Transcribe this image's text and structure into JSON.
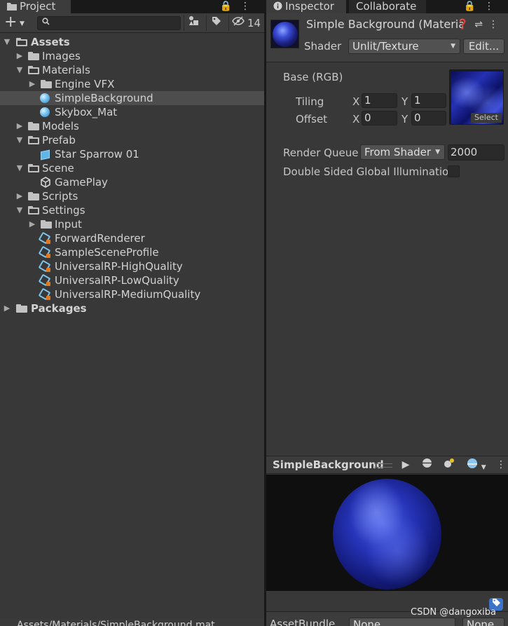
{
  "project": {
    "tab_label": "Project",
    "tab_icons": "🔒 ⋮",
    "toolbar": {
      "plus": "+",
      "search_value": "",
      "search_placeholder": "",
      "hidden_count": "14"
    },
    "tree": [
      {
        "label": "Assets",
        "bold": true
      },
      {
        "label": "Images"
      },
      {
        "label": "Materials"
      },
      {
        "label": "Engine VFX"
      },
      {
        "label": "SimpleBackground"
      },
      {
        "label": "Skybox_Mat"
      },
      {
        "label": "Models"
      },
      {
        "label": "Prefab"
      },
      {
        "label": "Star Sparrow 01"
      },
      {
        "label": "Scene"
      },
      {
        "label": "GamePlay"
      },
      {
        "label": "Scripts"
      },
      {
        "label": "Settings"
      },
      {
        "label": "Input"
      },
      {
        "label": "ForwardRenderer"
      },
      {
        "label": "SampleSceneProfile"
      },
      {
        "label": "UniversalRP-HighQuality"
      },
      {
        "label": "UniversalRP-LowQuality"
      },
      {
        "label": "UniversalRP-MediumQuality"
      },
      {
        "label": "Packages",
        "bold": true
      }
    ],
    "status_path": "Assets/Materials/SimpleBackground.mat"
  },
  "inspector": {
    "tabs": [
      "Inspector",
      "Collaborate"
    ],
    "tab_icons": "🔒 ⋮",
    "material_title": "Simple Background (Material)",
    "shader_label": "Shader",
    "shader_value": "Unlit/Texture",
    "edit_button": "Edit...",
    "base_label": "Base (RGB)",
    "tiling_label": "Tiling",
    "offset_label": "Offset",
    "x_axis": "X",
    "y_axis": "Y",
    "tiling_x": "1",
    "tiling_y": "1",
    "offset_x": "0",
    "offset_y": "0",
    "select_label": "Select",
    "render_queue_label": "Render Queue",
    "render_queue_mode": "From Shader",
    "render_queue_value": "2000",
    "dsgi_label": "Double Sided Global Illumination",
    "preview_title": "SimpleBackground",
    "assetbundle_label": "AssetBundle",
    "assetbundle_value": "None",
    "variant_value": "None"
  },
  "watermark": "CSDN @dangoxiba",
  "colors": {
    "panel_bg": "#383838",
    "tab_bar_bg": "#191919",
    "selected_row": "#4d4d4d",
    "field_bg": "#2a2a2a",
    "accent_blue": "#3b73c9"
  }
}
